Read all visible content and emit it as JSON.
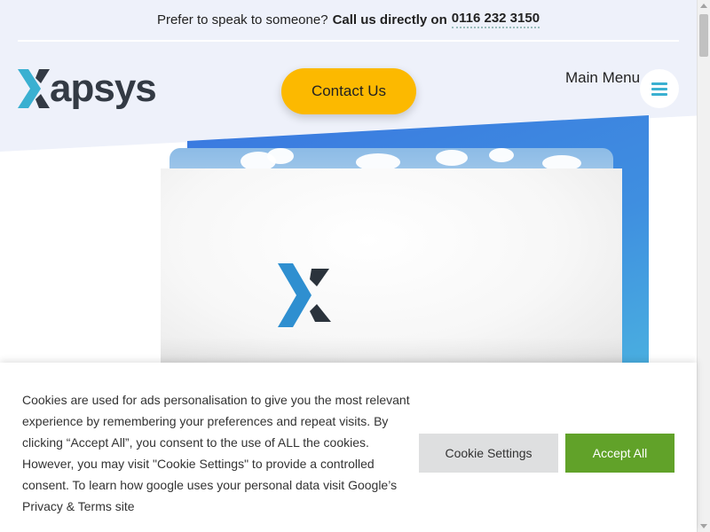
{
  "topbar": {
    "prompt": "Prefer to speak to someone?",
    "call_label": "Call us directly on",
    "phone": "0116 232 3150"
  },
  "header": {
    "logo_text": "apsys",
    "contact_label": "Contact Us",
    "menu_label": "Main Menu"
  },
  "cookie": {
    "message": "Cookies are used for ads personalisation to give you the most relevant experience by remembering your preferences and repeat visits. By clicking “Accept All”, you consent to the use of ALL the cookies. However, you may visit \"Cookie Settings\" to provide a controlled consent. To learn how google uses your personal data visit Google’s Privacy & Terms site",
    "settings_label": "Cookie Settings",
    "accept_label": "Accept All"
  },
  "colors": {
    "accent_yellow": "#fcb900",
    "accept_green": "#61a229",
    "brand_teal": "#3ab0d1",
    "brand_blue": "#3a78e0",
    "hero_bg": "#eef1fa"
  },
  "icons": {
    "menu": "hamburger-icon",
    "logo_mark": "x-logo-mark"
  }
}
